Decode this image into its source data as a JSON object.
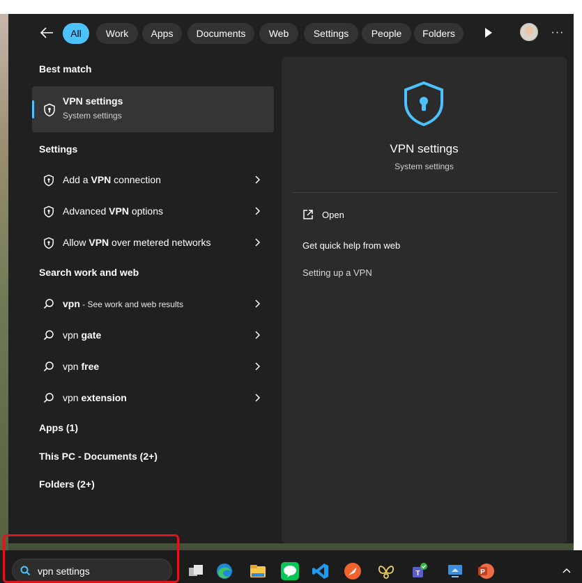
{
  "filters": {
    "back_label": "Back",
    "chips": [
      "All",
      "Work",
      "Apps",
      "Documents",
      "Web",
      "Settings",
      "People",
      "Folders"
    ],
    "more_label": "···"
  },
  "best_match": {
    "heading": "Best match",
    "title": "VPN settings",
    "subtitle": "System settings"
  },
  "settings": {
    "heading": "Settings",
    "items": [
      {
        "pre": "Add a ",
        "bold": "VPN",
        "post": " connection"
      },
      {
        "pre": "Advanced ",
        "bold": "VPN",
        "post": " options"
      },
      {
        "pre": "Allow ",
        "bold": "VPN",
        "post": " over metered networks"
      }
    ]
  },
  "web": {
    "heading": "Search work and web",
    "items": [
      {
        "pre": "",
        "bold": "vpn",
        "post": "",
        "small": " - See work and web results"
      },
      {
        "pre": "vpn ",
        "bold": "gate",
        "post": ""
      },
      {
        "pre": "vpn ",
        "bold": "free",
        "post": ""
      },
      {
        "pre": "vpn ",
        "bold": "extension",
        "post": ""
      }
    ]
  },
  "groups": {
    "apps": "Apps (1)",
    "documents": "This PC - Documents (2+)",
    "folders": "Folders (2+)"
  },
  "detail": {
    "title": "VPN settings",
    "subtitle": "System settings",
    "open_label": "Open",
    "help_heading": "Get quick help from web",
    "help_link": "Setting up a VPN"
  },
  "taskbar": {
    "search_value": "vpn settings",
    "apps": [
      "task-view",
      "edge",
      "file-explorer",
      "line",
      "vscode",
      "swift",
      "butterfly",
      "teams",
      "remote-desktop",
      "powerpoint"
    ]
  },
  "colors": {
    "accent": "#4cc2ff",
    "panel_bg": "#202020",
    "detail_bg": "#2b2b2b",
    "highlight": "#e0141b"
  }
}
